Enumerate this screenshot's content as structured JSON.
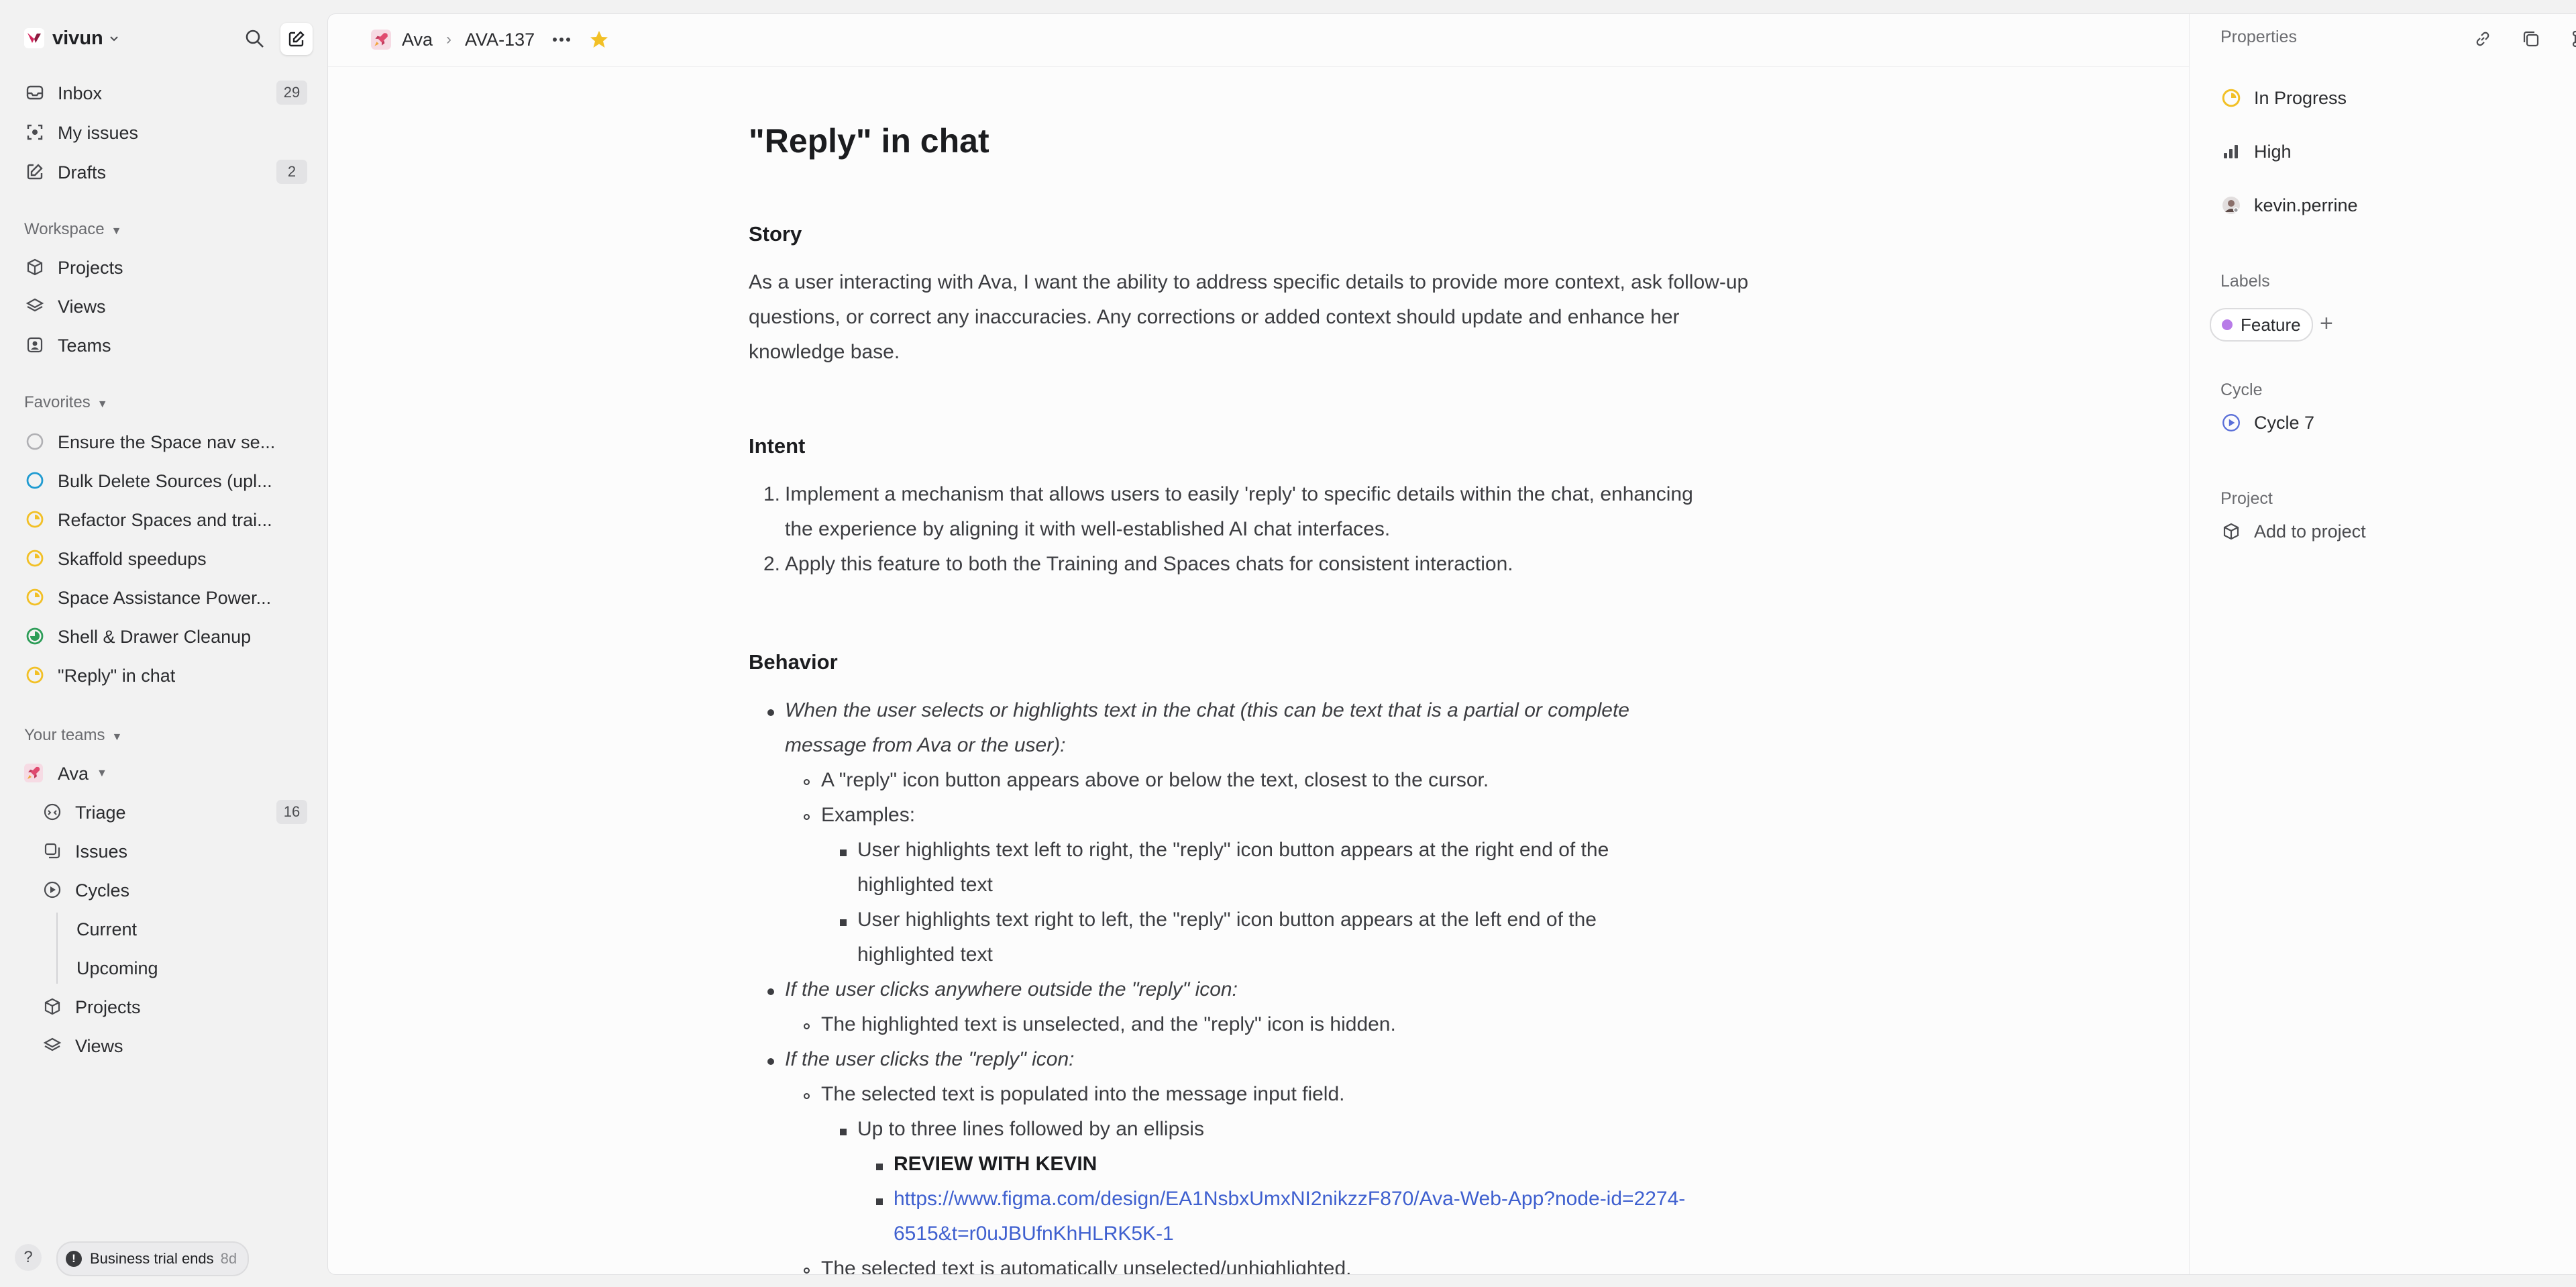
{
  "workspace": {
    "name": "vivun"
  },
  "nav": {
    "inbox": {
      "label": "Inbox",
      "count": "29"
    },
    "my_issues": {
      "label": "My issues"
    },
    "drafts": {
      "label": "Drafts",
      "count": "2"
    }
  },
  "workspace_section": {
    "title": "Workspace",
    "items": [
      {
        "label": "Projects"
      },
      {
        "label": "Views"
      },
      {
        "label": "Teams"
      }
    ]
  },
  "favorites": {
    "title": "Favorites",
    "items": [
      {
        "label": "Ensure the Space nav se...",
        "status": "todo"
      },
      {
        "label": "Bulk Delete Sources (upl...",
        "status": "todo-blue"
      },
      {
        "label": "Refactor Spaces and trai...",
        "status": "in-progress"
      },
      {
        "label": "Skaffold speedups",
        "status": "in-progress"
      },
      {
        "label": "Space Assistance Power...",
        "status": "in-progress"
      },
      {
        "label": "Shell & Drawer Cleanup",
        "status": "in-review"
      },
      {
        "label": "\"Reply\" in chat",
        "status": "in-progress"
      }
    ]
  },
  "teams": {
    "title": "Your teams",
    "team": {
      "name": "Ava"
    },
    "items": {
      "triage": {
        "label": "Triage",
        "count": "16"
      },
      "issues": {
        "label": "Issues"
      },
      "cycles": {
        "label": "Cycles"
      },
      "current": {
        "label": "Current"
      },
      "upcoming": {
        "label": "Upcoming"
      },
      "projects": {
        "label": "Projects"
      },
      "views": {
        "label": "Views"
      }
    }
  },
  "footer": {
    "help": "?",
    "trial_text": "Business trial ends",
    "trial_days": "8d"
  },
  "breadcrumb": {
    "team": "Ava",
    "issue_id": "AVA-137"
  },
  "issue": {
    "title": "\"Reply\" in chat",
    "story_heading": "Story",
    "story_text": "As a user interacting with Ava, I want the ability to address specific details to provide more context, ask follow-up questions, or correct any inaccuracies. Any corrections or added context should update and enhance her knowledge base.",
    "intent_heading": "Intent",
    "intent_items": [
      "Implement a mechanism that allows users to easily 'reply' to specific details within the chat, enhancing",
      "the experience by aligning it with well-established AI chat interfaces.",
      "Apply this feature to both the Training and Spaces chats for consistent interaction."
    ],
    "behavior_heading": "Behavior",
    "behavior_lines": [
      "When the user selects or highlights text in the chat (this can be text that is a partial or complete",
      "message from Ava or the user):",
      "A \"reply\" icon button appears above or below the text, closest to the cursor.",
      "Examples:",
      "User highlights text left to right, the \"reply\" icon button appears at the right end of the",
      "highlighted text",
      "User highlights text right to left, the \"reply\" icon button appears at the left end of the",
      "highlighted text",
      "If the user clicks anywhere outside the \"reply\" icon:",
      "The highlighted text is unselected, and the \"reply\" icon is hidden.",
      "If the user clicks the \"reply\" icon:",
      "The selected text is populated into the message input field.",
      "Up to three lines followed by an ellipsis",
      "REVIEW WITH KEVIN",
      "https://www.figma.com/design/EA1NsbxUmxNI2nikzzF870/Ava-Web-App?node-id=2274-",
      "6515&t=r0uJBUfnKhHLRK5K-1",
      "The selected text is automatically unselected/unhighlighted."
    ]
  },
  "properties": {
    "title": "Properties",
    "status": "In Progress",
    "priority": "High",
    "assignee": "kevin.perrine",
    "labels_title": "Labels",
    "label": "Feature",
    "cycle_title": "Cycle",
    "cycle": "Cycle 7",
    "project_title": "Project",
    "project_action": "Add to project"
  },
  "colors": {
    "in_progress": "#f2c026",
    "in_review": "#2d9d58",
    "todo_blue": "#1f9bd1",
    "feature_label": "#b87be8",
    "favorite_star": "#f2c026",
    "link": "#3e5fcf"
  }
}
